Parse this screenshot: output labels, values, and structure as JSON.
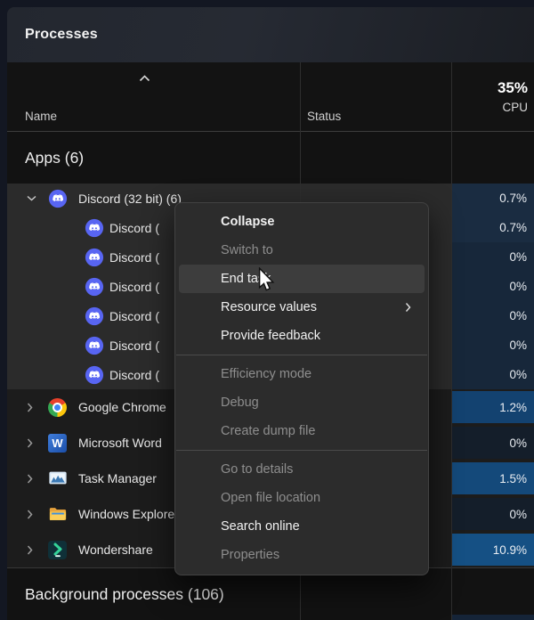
{
  "header": {
    "title": "Processes"
  },
  "table_header": {
    "name_col": "Name",
    "status_col": "Status",
    "cpu_percent": "35%",
    "cpu_col": "CPU",
    "sort_icon": "chevron-up"
  },
  "sections": {
    "apps_label": "Apps (6)",
    "background_label": "Background processes (106)"
  },
  "rows": {
    "discord_parent": {
      "name": "Discord (32 bit) (6)",
      "cpu": "0.7%",
      "icon": "discord-icon",
      "expanded": true
    },
    "discord_children": [
      {
        "name": "Discord (",
        "cpu": "0.7%",
        "icon": "discord-icon"
      },
      {
        "name": "Discord (",
        "cpu": "0%",
        "icon": "discord-icon"
      },
      {
        "name": "Discord (",
        "cpu": "0%",
        "icon": "discord-icon"
      },
      {
        "name": "Discord (",
        "cpu": "0%",
        "icon": "discord-icon"
      },
      {
        "name": "Discord (",
        "cpu": "0%",
        "icon": "discord-icon"
      },
      {
        "name": "Discord (",
        "cpu": "0%",
        "icon": "discord-icon"
      }
    ],
    "apps": [
      {
        "name": "Google Chrome",
        "cpu": "1.2%",
        "icon": "chrome-icon"
      },
      {
        "name": "Microsoft Word",
        "cpu": "0%",
        "icon": "word-icon"
      },
      {
        "name": "Task Manager",
        "cpu": "1.5%",
        "icon": "task-manager-icon"
      },
      {
        "name": "Windows Explorer",
        "cpu": "0%",
        "icon": "folder-icon"
      },
      {
        "name": "Wondershare",
        "cpu": "10.9%",
        "icon": "wondershare-icon"
      }
    ]
  },
  "context_menu": {
    "items": [
      {
        "label": "Collapse",
        "state": "bold"
      },
      {
        "label": "Switch to",
        "state": "disabled"
      },
      {
        "label": "End task",
        "state": "highlighted"
      },
      {
        "label": "Resource values",
        "state": "normal",
        "has_submenu": true
      },
      {
        "label": "Provide feedback",
        "state": "normal"
      },
      {
        "label": "Efficiency mode",
        "state": "disabled"
      },
      {
        "label": "Debug",
        "state": "disabled"
      },
      {
        "label": "Create dump file",
        "state": "disabled"
      },
      {
        "label": "Go to details",
        "state": "disabled"
      },
      {
        "label": "Open file location",
        "state": "disabled"
      },
      {
        "label": "Search online",
        "state": "normal"
      },
      {
        "label": "Properties",
        "state": "disabled"
      }
    ]
  },
  "icons": {
    "word_letter": "W"
  },
  "colors": {
    "cpu_low": "#1a2c41",
    "cpu_zero": "#17273a",
    "cpu_zero_dim": "#141e2a",
    "cpu_mid1": "#134270",
    "cpu_mid2": "#14497a",
    "cpu_high": "#155084",
    "cpu_sliver": "#152438",
    "menu_bg": "#2c2c2c",
    "menu_highlight": "#3d3d3d",
    "group_selected_bg": "#2b2b2b",
    "discord_brand": "#5865f2"
  }
}
